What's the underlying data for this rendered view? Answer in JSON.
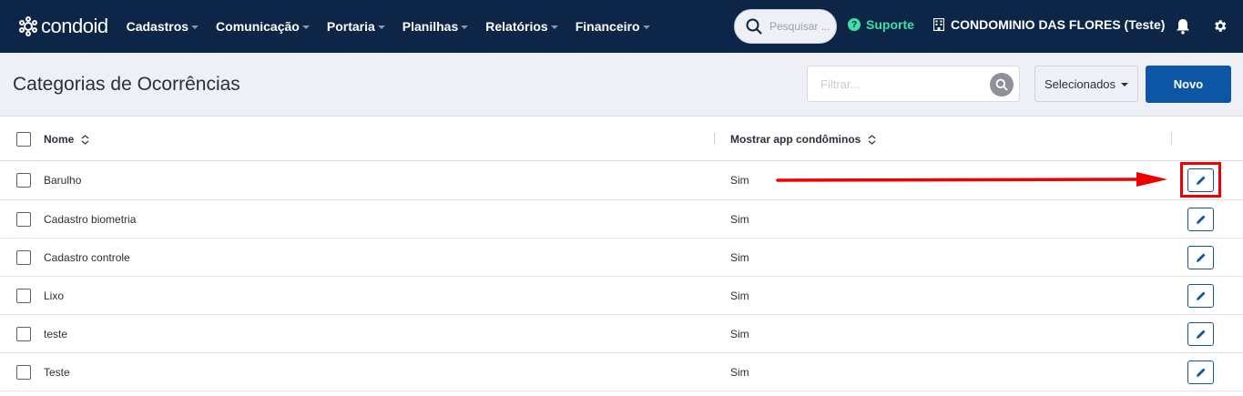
{
  "brand": {
    "name": "condoid"
  },
  "nav": {
    "items": [
      {
        "label": "Cadastros"
      },
      {
        "label": "Comunicação"
      },
      {
        "label": "Portaria"
      },
      {
        "label": "Planilhas"
      },
      {
        "label": "Relatórios"
      },
      {
        "label": "Financeiro"
      }
    ]
  },
  "header": {
    "search_placeholder": "Pesquisar ...",
    "support_label": "Suporte",
    "condo_name": "CONDOMINIO DAS FLORES (Teste)"
  },
  "toolbar": {
    "title": "Categorias de Ocorrências",
    "filter_placeholder": "Filtrar...",
    "selected_label": "Selecionados",
    "new_label": "Novo"
  },
  "table": {
    "columns": {
      "name": "Nome",
      "show_app": "Mostrar app condôminos"
    },
    "rows": [
      {
        "name": "Barulho",
        "show_app": "Sim"
      },
      {
        "name": "Cadastro biometria",
        "show_app": "Sim"
      },
      {
        "name": "Cadastro controle",
        "show_app": "Sim"
      },
      {
        "name": "Lixo",
        "show_app": "Sim"
      },
      {
        "name": "teste",
        "show_app": "Sim"
      },
      {
        "name": "Teste",
        "show_app": "Sim"
      }
    ]
  },
  "colors": {
    "topbar": "#0d2546",
    "accent": "#0d56a6",
    "support": "#3fe0a4",
    "annotation": "#ee0000"
  },
  "icons": [
    "condoid-logo-icon",
    "search-icon",
    "help-icon",
    "building-icon",
    "bell-icon",
    "gear-icon",
    "sort-icon",
    "pencil-icon",
    "arrow-annotation"
  ]
}
